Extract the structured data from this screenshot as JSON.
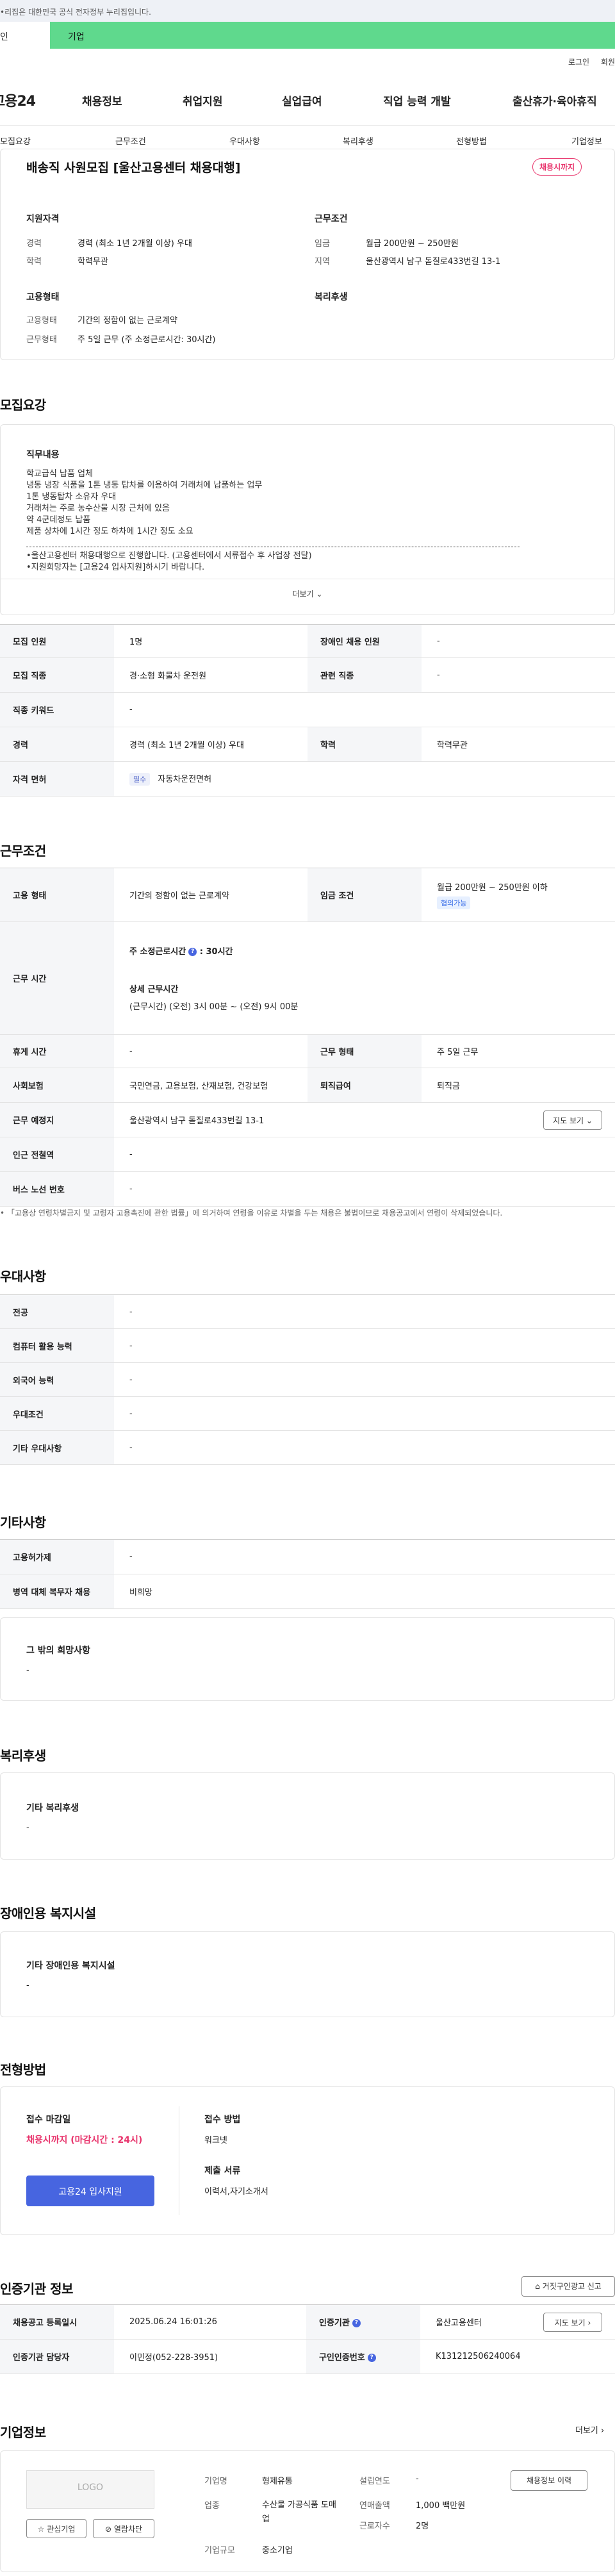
{
  "gov_notice": "•리집은 대한민국 공식 전자정부 누리집입니다.",
  "user_tabs": {
    "personal": "인",
    "company": "기업"
  },
  "util": {
    "login": "로그인",
    "join": "회원"
  },
  "logo": "고용24",
  "gnb": [
    "채용정보",
    "취업지원",
    "실업급여",
    "직업 능력 개발",
    "출산휴가·육아휴직"
  ],
  "anchor_nav": [
    "모집요강",
    "근무조건",
    "우대사항",
    "복리후생",
    "전형방법",
    "기업정보"
  ],
  "summary": {
    "title": "배송직 사원모집 [울산고용센터 채용대행]",
    "status_badge": "채용시까지",
    "qual_title": "지원자격",
    "qual": [
      {
        "label": "경력",
        "value": "경력 (최소 1년 2개월 이상) 우대"
      },
      {
        "label": "학력",
        "value": "학력무관"
      }
    ],
    "cond_title": "근무조건",
    "cond": [
      {
        "label": "임금",
        "value": "월급 200만원 ~ 250만원"
      },
      {
        "label": "지역",
        "value": "울산광역시 남구 돋질로433번길 13-1"
      }
    ],
    "emp_title": "고용형태",
    "emp": [
      {
        "label": "고용형태",
        "value": "기간의 정함이 없는 근로계약"
      },
      {
        "label": "근무형태",
        "value": "주 5일 근무 (주 소정근로시간: 30시간)"
      }
    ],
    "welfare_title": "복리후생"
  },
  "recruit": {
    "section_title": "모집요강",
    "duty_title": "직무내용",
    "duty_lines": [
      "학교급식 납품 업체",
      "냉동 냉장 식품을 1톤 냉동 탑차를 이용하여 거래처에 납품하는 업무",
      "1톤 냉동탑차 소유자 우대",
      "거래처는 주로 농수산물 시장 근처에 있음",
      "약 4군데정도 납품",
      "제품 상차에 1시간 정도 하차에 1시간 정도 소요"
    ],
    "notice_lines": [
      "•울산고용센터 채용대행으로 진행합니다. (고용센터에서 서류접수 후 사업장 전달)",
      "•지원희망자는 [고용24 입사지원]하시기 바랍니다."
    ],
    "more": "더보기",
    "rows": [
      {
        "l1": "모집 인원",
        "v1": "1명",
        "l2": "장애인 채용 인원",
        "v2": "-"
      },
      {
        "l1": "모집 직종",
        "v1": "경·소형 화물차 운전원",
        "l2": "관련 직종",
        "v2": "-"
      },
      {
        "l1": "직종 키워드",
        "v1": "-"
      },
      {
        "l1": "경력",
        "v1": "경력 (최소 1년 2개월 이상) 우대",
        "l2": "학력",
        "v2": "학력무관"
      },
      {
        "l1": "자격 면허",
        "pill": "필수",
        "v1": "자동차운전면허"
      }
    ]
  },
  "work": {
    "section_title": "근무조건",
    "emp_label": "고용 형태",
    "emp_value": "기간의 정함이 없는 근로계약",
    "wage_label": "임금 조건",
    "wage_value": "월급 200만원 ~ 250만원 이하",
    "wage_pill": "협의가능",
    "time_label": "근무 시간",
    "week_hours_label": "주 소정근로시간",
    "week_hours_value": ": 30시간",
    "detail_label": "상세 근무시간",
    "detail_value": "(근무시간) (오전) 3시 00분 ~ (오전) 9시 00분",
    "rest_label": "휴게 시간",
    "rest_value": "-",
    "shape_label": "근무 형태",
    "shape_value": "주 5일 근무",
    "insurance_label": "사회보험",
    "insurance_value": "국민연금, 고용보험, 산재보험, 건강보험",
    "severance_label": "퇴직급여",
    "severance_value": "퇴직금",
    "place_label": "근무 예정지",
    "place_value": "울산광역시 남구 돋질로433번길 13-1",
    "map_btn": "지도 보기",
    "station_label": "인근 전철역",
    "station_value": "-",
    "bus_label": "버스 노선 번호",
    "bus_value": "-",
    "footnote": "「고용상 연령차별금지 및 고령자 고용촉진에 관한 법률」에 의거하여 연령을 이유로 차별을 두는 채용은 불법이므로 채용공고에서 연령이 삭제되었습니다."
  },
  "pref": {
    "section_title": "우대사항",
    "rows": [
      {
        "label": "전공",
        "value": "-"
      },
      {
        "label": "컴퓨터 활용 능력",
        "value": "-"
      },
      {
        "label": "외국어 능력",
        "value": "-"
      },
      {
        "label": "우대조건",
        "value": "-"
      },
      {
        "label": "기타 우대사항",
        "value": "-"
      }
    ]
  },
  "etc": {
    "section_title": "기타사항",
    "rows": [
      {
        "label": "고용허가제",
        "value": "-"
      },
      {
        "label": "병역 대체 복무자 채용",
        "value": "비희망"
      }
    ],
    "hope_title": "그 밖의 희망사항",
    "hope_value": "-"
  },
  "welfare": {
    "section_title": "복리후생",
    "box_title": "기타 복리후생",
    "box_value": "-"
  },
  "disabled": {
    "section_title": "장애인용 복지시설",
    "box_title": "기타 장애인용 복지시설",
    "box_value": "-"
  },
  "process": {
    "section_title": "전형방법",
    "deadline_label": "접수 마감일",
    "deadline_value": "채용시까지 (마감시간 : 24시)",
    "apply_btn": "고용24 입사지원",
    "method_label": "접수 방법",
    "method_value": "워크넷",
    "docs_label": "제출 서류",
    "docs_value": "이력서,자기소개서"
  },
  "cert": {
    "section_title": "인증기관 정보",
    "report_btn": "거짓구인광고 신고",
    "rows": [
      {
        "l1": "채용공고 등록일시",
        "v1": "2025.06.24 16:01:26",
        "l2": "인증기관",
        "v2": "울산고용센터",
        "btn": "지도 보기"
      },
      {
        "l1": "인증기관 담당자",
        "v1": "이민정(052-228-3951)",
        "l2": "구인인증번호",
        "v2": "K131212506240064"
      }
    ]
  },
  "company": {
    "section_title": "기업정보",
    "more": "더보기",
    "logo_text": "LOGO",
    "interest_btn": "관심기업",
    "block_btn": "열람차단",
    "history_btn": "채용정보 이력",
    "fields": [
      {
        "label": "기업명",
        "value": "형제유통"
      },
      {
        "label": "업종",
        "value": "수산물 가공식품 도매업"
      },
      {
        "label": "기업규모",
        "value": "중소기업"
      },
      {
        "label": "설립연도",
        "value": "-"
      },
      {
        "label": "연매출액",
        "value": "1,000 백만원"
      },
      {
        "label": "근로자수",
        "value": "2명"
      }
    ]
  }
}
